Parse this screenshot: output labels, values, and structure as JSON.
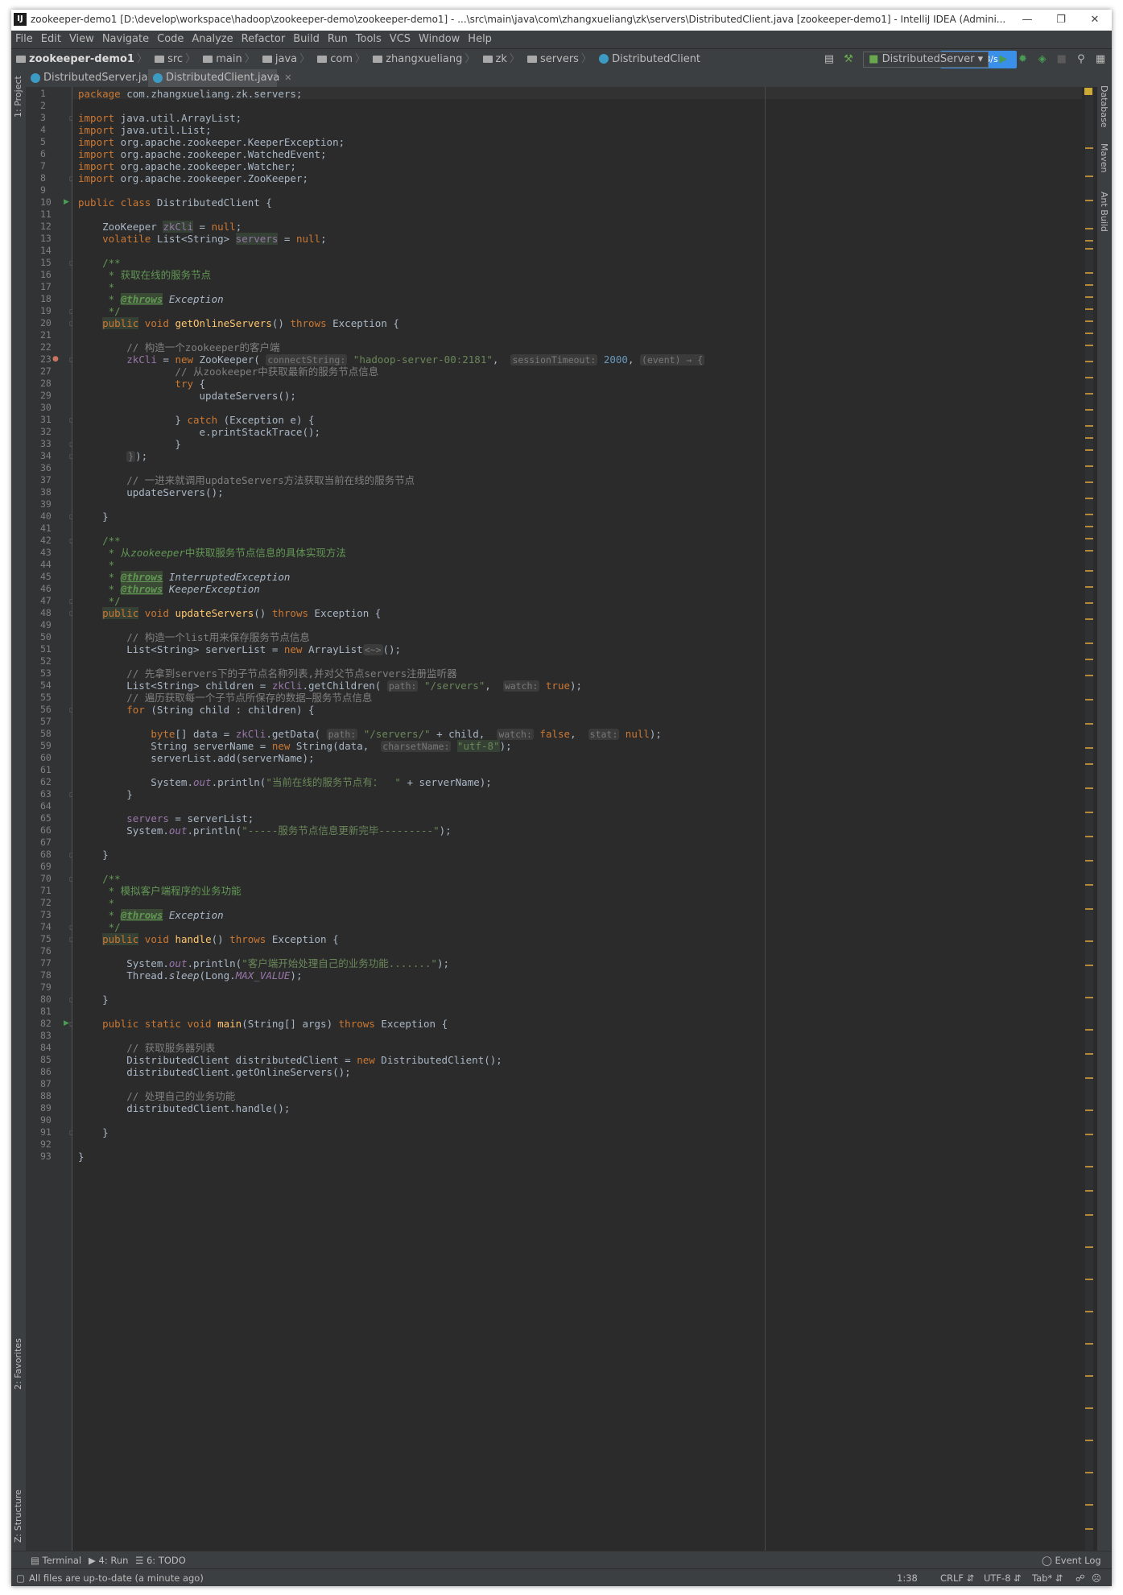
{
  "window": {
    "title": "zookeeper-demo1 [D:\\develop\\workspace\\hadoop\\zookeeper-demo\\zookeeper-demo1] - ...\\src\\main\\java\\com\\zhangxueliang\\zk\\servers\\DistributedClient.java [zookeeper-demo1] - IntelliJ IDEA (Admini..."
  },
  "menu": [
    "File",
    "Edit",
    "View",
    "Navigate",
    "Code",
    "Analyze",
    "Refactor",
    "Build",
    "Run",
    "Tools",
    "VCS",
    "Window",
    "Help"
  ],
  "breadcrumbs": [
    "zookeeper-demo1",
    "src",
    "main",
    "java",
    "com",
    "zhangxueliang",
    "zk",
    "servers",
    "DistributedClient"
  ],
  "toolbar": {
    "run_config": "DistributedServer",
    "speed_badge": "115 KB/s",
    "icons": [
      "build-icon",
      "hammer-icon",
      "run-icon",
      "debug-icon",
      "coverage-icon",
      "stop-icon",
      "search-icon",
      "project-structure-icon"
    ]
  },
  "tabs": [
    {
      "label": "DistributedServer.java",
      "active": false
    },
    {
      "label": "DistributedClient.java",
      "active": true
    }
  ],
  "side_tabs": {
    "left_top": "1: Project",
    "left_bottom": [
      "2: Favorites",
      "Z: Structure"
    ],
    "right": [
      "Database",
      "Maven",
      "Ant Build"
    ]
  },
  "gutter": {
    "run_lines": [
      10,
      82
    ],
    "fold_lines": [
      3,
      8,
      15,
      19,
      20,
      23,
      24,
      31,
      33,
      34,
      40,
      42,
      47,
      48,
      56,
      63,
      68,
      70,
      74,
      75,
      80,
      82,
      91
    ]
  },
  "code_lines": [
    {
      "n": "1",
      "h": "<span class=\"kw\">package</span> com.zhangxueliang.zk.servers;"
    },
    {
      "n": "2",
      "h": ""
    },
    {
      "n": "3",
      "h": "<span class=\"kw\">import</span> java.util.ArrayList;"
    },
    {
      "n": "4",
      "h": "<span class=\"kw\">import</span> java.util.List;"
    },
    {
      "n": "5",
      "h": "<span class=\"kw\">import</span> org.apache.zookeeper.KeeperException;"
    },
    {
      "n": "6",
      "h": "<span class=\"kw\">import</span> org.apache.zookeeper.WatchedEvent;"
    },
    {
      "n": "7",
      "h": "<span class=\"kw\">import</span> org.apache.zookeeper.Watcher;"
    },
    {
      "n": "8",
      "h": "<span class=\"kw\">import</span> org.apache.zookeeper.ZooKeeper;"
    },
    {
      "n": "9",
      "h": ""
    },
    {
      "n": "10",
      "h": "<span class=\"kw\">public class</span> DistributedClient {"
    },
    {
      "n": "11",
      "h": ""
    },
    {
      "n": "12",
      "h": "    ZooKeeper <span class=\"field hl\">zkCli</span> = <span class=\"kw\">null</span>;"
    },
    {
      "n": "13",
      "h": "    <span class=\"kw\">volatile</span> List&lt;String&gt; <span class=\"field hl\">servers</span> = <span class=\"kw\">null</span>;"
    },
    {
      "n": "14",
      "h": ""
    },
    {
      "n": "15",
      "h": "    <span class=\"doc\">/**</span>"
    },
    {
      "n": "16",
      "h": "<span class=\"doc\">     * 获取在线的服务节点</span>"
    },
    {
      "n": "17",
      "h": "<span class=\"doc\">     *</span>"
    },
    {
      "n": "18",
      "h": "<span class=\"doc\">     * </span><span class=\"doctag ital\">@throws</span> <span class=\"ital\">Exception</span>"
    },
    {
      "n": "19",
      "h": "<span class=\"doc\">     */</span>"
    },
    {
      "n": "20",
      "h": "    <span class=\"kw hl\">public</span> <span class=\"kw\">void</span> <span class=\"fn\">getOnlineServers</span>() <span class=\"kw\">throws</span> Exception {"
    },
    {
      "n": "21",
      "h": ""
    },
    {
      "n": "22",
      "h": "        <span class=\"cm\">// 构造一个zookeeper的客户端</span>"
    },
    {
      "n": "23",
      "h": "        <span class=\"field\">zkCli</span> = <span class=\"kw\">new</span> ZooKeeper( <span class=\"hint\">connectString:</span> <span class=\"str\">\"hadoop-server-00:2181\"</span>,  <span class=\"hint\">sessionTimeout:</span> <span style=\"color:#6897bb\">2000</span>, <span class=\"hint\">(event) → {</span>"
    },
    {
      "n": "27",
      "h": "                <span class=\"cm\">// 从zookeeper中获取最新的服务节点信息</span>"
    },
    {
      "n": "28",
      "h": "                <span class=\"kw\">try</span> {"
    },
    {
      "n": "29",
      "h": "                    updateServers();"
    },
    {
      "n": "30",
      "h": ""
    },
    {
      "n": "31",
      "h": "                } <span class=\"kw\">catch</span> (Exception e) {"
    },
    {
      "n": "32",
      "h": "                    e.printStackTrace();"
    },
    {
      "n": "33",
      "h": "                }"
    },
    {
      "n": "34",
      "h": "        <span class=\"hint\">}</span>);"
    },
    {
      "n": "36",
      "h": ""
    },
    {
      "n": "37",
      "h": "        <span class=\"cm\">// 一进来就调用updateServers方法获取当前在线的服务节点</span>"
    },
    {
      "n": "38",
      "h": "        updateServers();"
    },
    {
      "n": "39",
      "h": ""
    },
    {
      "n": "40",
      "h": "    }"
    },
    {
      "n": "41",
      "h": ""
    },
    {
      "n": "42",
      "h": "    <span class=\"doc\">/**</span>"
    },
    {
      "n": "43",
      "h": "<span class=\"doc\">     * 从<span class=\"ital\">zookeeper</span>中获取服务节点信息的具体实现方法</span>"
    },
    {
      "n": "44",
      "h": "<span class=\"doc\">     *</span>"
    },
    {
      "n": "45",
      "h": "<span class=\"doc\">     * </span><span class=\"doctag ital\">@throws</span> <span class=\"ital\">InterruptedException</span>"
    },
    {
      "n": "46",
      "h": "<span class=\"doc\">     * </span><span class=\"doctag ital\">@throws</span> <span class=\"ital\">KeeperException</span>"
    },
    {
      "n": "47",
      "h": "<span class=\"doc\">     */</span>"
    },
    {
      "n": "48",
      "h": "    <span class=\"kw hl\">public</span> <span class=\"kw\">void</span> <span class=\"fn\">updateServers</span>() <span class=\"kw\">throws</span> Exception {"
    },
    {
      "n": "49",
      "h": ""
    },
    {
      "n": "50",
      "h": "        <span class=\"cm\">// 构造一个list用来保存服务节点信息</span>"
    },
    {
      "n": "51",
      "h": "        List&lt;String&gt; serverList = <span class=\"kw\">new</span> ArrayList<span class=\"hint\">&lt;~&gt;</span>();"
    },
    {
      "n": "52",
      "h": ""
    },
    {
      "n": "53",
      "h": "        <span class=\"cm\">// 先拿到servers下的子节点名称列表,并对父节点servers注册监听器</span>"
    },
    {
      "n": "54",
      "h": "        List&lt;String&gt; children = <span class=\"field\">zkCli</span>.getChildren( <span class=\"hint\">path:</span> <span class=\"str\">\"/servers\"</span>,  <span class=\"hint\">watch:</span> <span class=\"kw\">true</span>);"
    },
    {
      "n": "55",
      "h": "        <span class=\"cm\">// 遍历获取每一个子节点所保存的数据—服务节点信息</span>"
    },
    {
      "n": "56",
      "h": "        <span class=\"kw\">for</span> (String child : children) {"
    },
    {
      "n": "57",
      "h": ""
    },
    {
      "n": "58",
      "h": "            <span class=\"kw\">byte</span>[] data = <span class=\"field\">zkCli</span>.getData( <span class=\"hint\">path:</span> <span class=\"str\">\"/servers/\"</span> + child,  <span class=\"hint\">watch:</span> <span class=\"kw\">false</span>,  <span class=\"hint\">stat:</span> <span class=\"kw\">null</span>);"
    },
    {
      "n": "59",
      "h": "            String serverName = <span class=\"kw\">new</span> String(data,  <span class=\"hint\">charsetName:</span> <span class=\"str hl\">\"utf-8\"</span>);"
    },
    {
      "n": "60",
      "h": "            serverList.add(serverName);"
    },
    {
      "n": "61",
      "h": ""
    },
    {
      "n": "62",
      "h": "            System.<span class=\"field ital\">out</span>.println(<span class=\"str\">\"当前在线的服务节点有：  \"</span> + serverName);"
    },
    {
      "n": "63",
      "h": "        }"
    },
    {
      "n": "64",
      "h": ""
    },
    {
      "n": "65",
      "h": "        <span class=\"field\">servers</span> = serverList;"
    },
    {
      "n": "66",
      "h": "        System.<span class=\"field ital\">out</span>.println(<span class=\"str\">\"-----服务节点信息更新完毕---------\"</span>);"
    },
    {
      "n": "67",
      "h": ""
    },
    {
      "n": "68",
      "h": "    }"
    },
    {
      "n": "69",
      "h": ""
    },
    {
      "n": "70",
      "h": "    <span class=\"doc\">/**</span>"
    },
    {
      "n": "71",
      "h": "<span class=\"doc\">     * 模拟客户端程序的业务功能</span>"
    },
    {
      "n": "72",
      "h": "<span class=\"doc\">     *</span>"
    },
    {
      "n": "73",
      "h": "<span class=\"doc\">     * </span><span class=\"doctag ital\">@throws</span> <span class=\"ital\">Exception</span>"
    },
    {
      "n": "74",
      "h": "<span class=\"doc\">     */</span>"
    },
    {
      "n": "75",
      "h": "    <span class=\"kw hl\">public</span> <span class=\"kw\">void</span> <span class=\"fn\">handle</span>() <span class=\"kw\">throws</span> Exception {"
    },
    {
      "n": "76",
      "h": ""
    },
    {
      "n": "77",
      "h": "        System.<span class=\"field ital\">out</span>.println(<span class=\"str\">\"客户端开始处理自己的业务功能.......\"</span>);"
    },
    {
      "n": "78",
      "h": "        Thread.<span class=\"ital\">sleep</span>(Long.<span class=\"field ital\">MAX_VALUE</span>);"
    },
    {
      "n": "79",
      "h": ""
    },
    {
      "n": "80",
      "h": "    }"
    },
    {
      "n": "81",
      "h": ""
    },
    {
      "n": "82",
      "h": "    <span class=\"kw\">public static void</span> <span class=\"fn\">main</span>(String[] args) <span class=\"kw\">throws</span> Exception {"
    },
    {
      "n": "83",
      "h": ""
    },
    {
      "n": "84",
      "h": "        <span class=\"cm\">// 获取服务器列表</span>"
    },
    {
      "n": "85",
      "h": "        DistributedClient distributedClient = <span class=\"kw\">new</span> DistributedClient();"
    },
    {
      "n": "86",
      "h": "        distributedClient.getOnlineServers();"
    },
    {
      "n": "87",
      "h": ""
    },
    {
      "n": "88",
      "h": "        <span class=\"cm\">// 处理自己的业务功能</span>"
    },
    {
      "n": "89",
      "h": "        distributedClient.handle();"
    },
    {
      "n": "90",
      "h": ""
    },
    {
      "n": "91",
      "h": "    }"
    },
    {
      "n": "92",
      "h": ""
    },
    {
      "n": "93",
      "h": "}"
    }
  ],
  "bottom_tools": [
    "Terminal",
    "4: Run",
    "6: TODO"
  ],
  "event_log": "Event Log",
  "status": {
    "message": "All files are up-to-date (a minute ago)",
    "position": "1:38",
    "line_sep": "CRLF",
    "encoding": "UTF-8",
    "indent": "Tab*"
  },
  "colors": {
    "editor_bg": "#2b2b2b",
    "keyword": "#cc7832",
    "string": "#6a8759",
    "field": "#9876aa",
    "comment": "#808080",
    "run_icon": "#499c54"
  }
}
